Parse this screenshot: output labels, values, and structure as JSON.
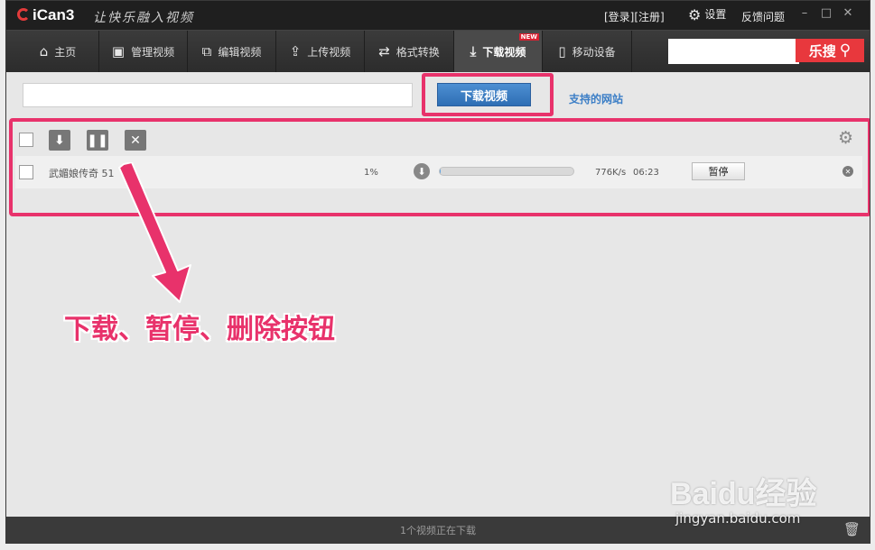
{
  "titlebar": {
    "app_name": "iCan3",
    "slogan": "让快乐融入视频",
    "login": "[登录]",
    "register": "[注册]",
    "settings": "设置",
    "feedback": "反馈问题",
    "minimize_glyph": "–",
    "maximize_glyph": "□",
    "close_glyph": "✕"
  },
  "toolbar": {
    "tabs": [
      {
        "label": "主页",
        "icon": "home-icon"
      },
      {
        "label": "管理视频",
        "icon": "manage-video-icon"
      },
      {
        "label": "编辑视频",
        "icon": "edit-video-icon"
      },
      {
        "label": "上传视频",
        "icon": "upload-icon"
      },
      {
        "label": "格式转换",
        "icon": "convert-icon"
      },
      {
        "label": "下载视频",
        "icon": "download-icon",
        "active": true,
        "badge": "NEW"
      },
      {
        "label": "移动设备",
        "icon": "mobile-device-icon"
      }
    ],
    "search_placeholder": "",
    "search_button": "乐搜"
  },
  "download_bar": {
    "url_value": "",
    "download_button": "下载视频",
    "supported_sites": "支持的网站"
  },
  "task_list": {
    "items": [
      {
        "name": "武媚娘传奇 51",
        "percent_label": "1%",
        "progress": 0.01,
        "speed": "776K/s",
        "time": "06:23",
        "action": "暂停"
      }
    ]
  },
  "annotation": {
    "text": "下载、暂停、删除按钮"
  },
  "statusbar": {
    "text": "1个视频正在下载"
  },
  "watermark": {
    "brand": "Baidu经验",
    "url": "jingyan.baidu.com"
  },
  "colors": {
    "accent_red": "#e8383d",
    "highlight_pink": "#e8326b",
    "button_blue": "#2e6eb4",
    "link_blue": "#3b7ec6"
  }
}
